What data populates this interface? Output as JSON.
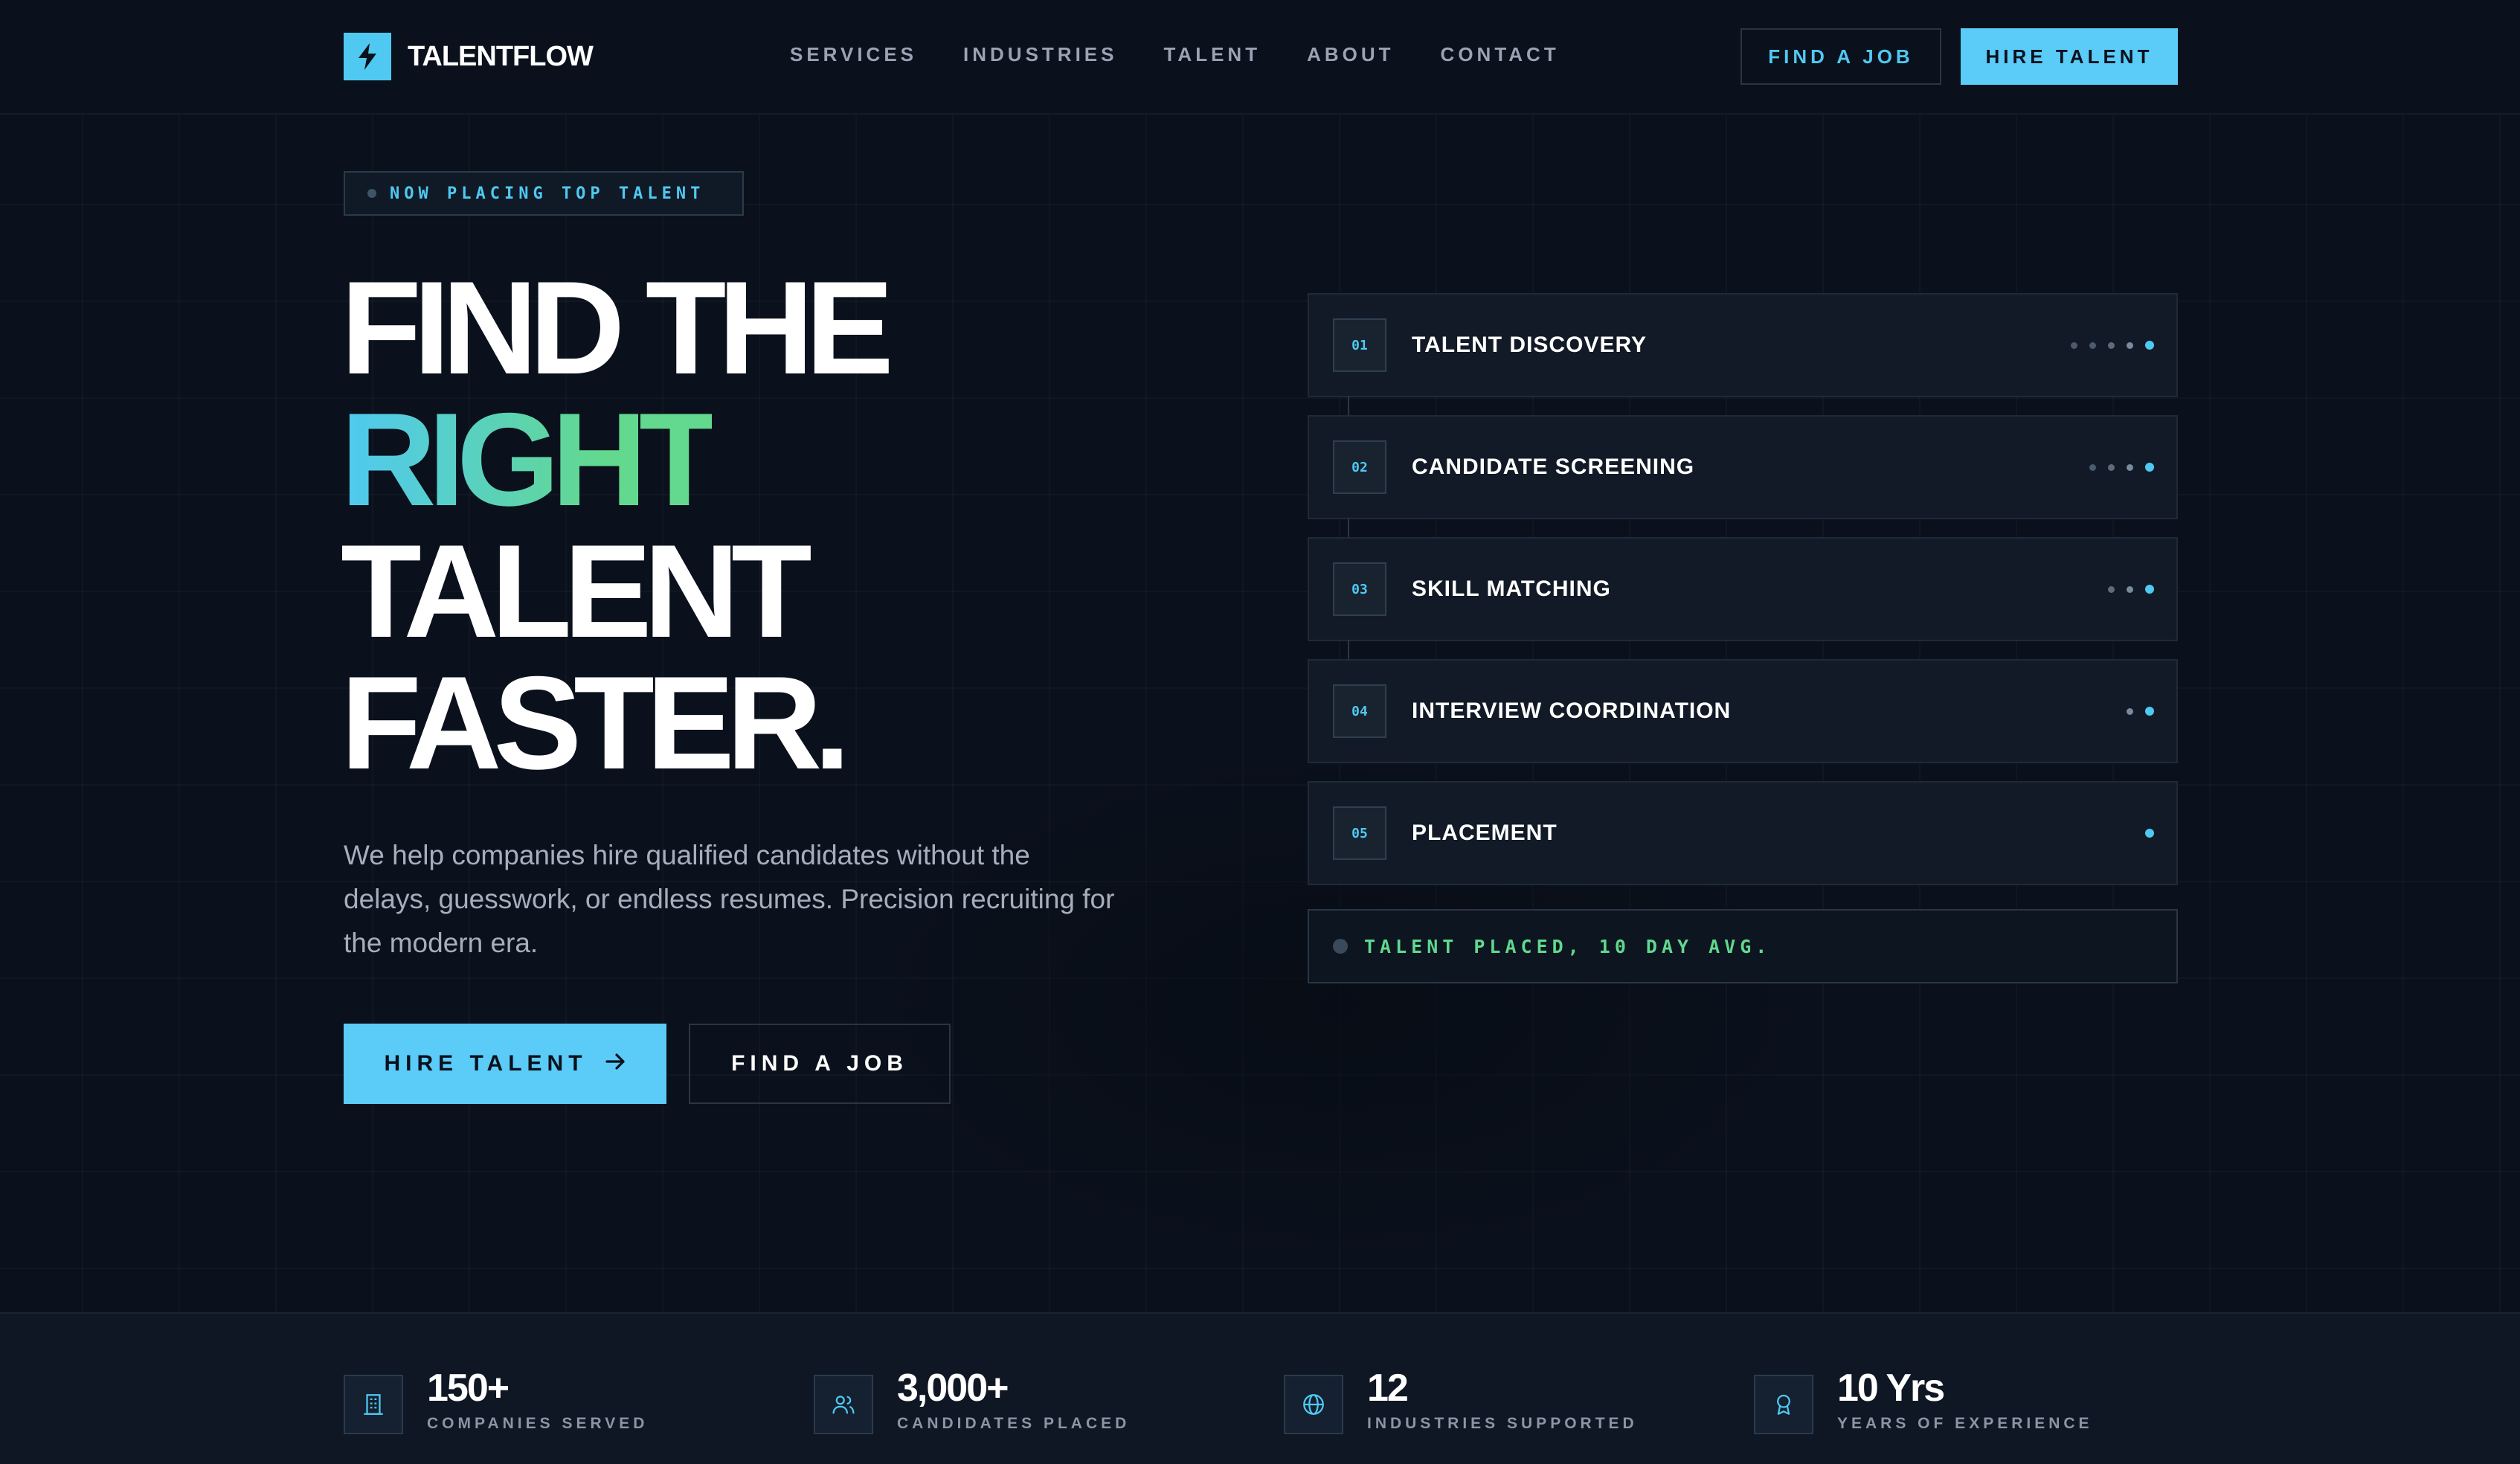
{
  "brand": {
    "name": "TALENTFLOW",
    "icon": "lightning-bolt-icon"
  },
  "nav": {
    "links": [
      "SERVICES",
      "INDUSTRIES",
      "TALENT",
      "ABOUT",
      "CONTACT"
    ],
    "find_job": "FIND A JOB",
    "hire_talent": "HIRE TALENT"
  },
  "hero": {
    "tagline": "NOW PLACING TOP TALENT",
    "headline": {
      "line1": "FIND THE",
      "line2": "RIGHT",
      "line3": "TALENT",
      "line4": "FASTER."
    },
    "description": "We help companies hire qualified candidates without the delays, guesswork, or endless resumes. Precision recruiting for the modern era.",
    "primary_cta": "HIRE TALENT",
    "secondary_cta": "FIND A JOB"
  },
  "process": {
    "steps": [
      {
        "num": "01",
        "label": "TALENT DISCOVERY",
        "level": 5
      },
      {
        "num": "02",
        "label": "CANDIDATE SCREENING",
        "level": 4
      },
      {
        "num": "03",
        "label": "SKILL MATCHING",
        "level": 3
      },
      {
        "num": "04",
        "label": "INTERVIEW COORDINATION",
        "level": 2
      },
      {
        "num": "05",
        "label": "PLACEMENT",
        "level": 1
      }
    ],
    "status": "TALENT PLACED, 10 DAY AVG."
  },
  "stats": [
    {
      "value": "150+",
      "label": "COMPANIES SERVED",
      "icon": "building-icon"
    },
    {
      "value": "3,000+",
      "label": "CANDIDATES PLACED",
      "icon": "users-icon"
    },
    {
      "value": "12",
      "label": "INDUSTRIES SUPPORTED",
      "icon": "globe-icon"
    },
    {
      "value": "10 Yrs",
      "label": "YEARS OF EXPERIENCE",
      "icon": "award-icon"
    }
  ],
  "colors": {
    "background": "#0b111c",
    "accent_blue": "#5bcbf8",
    "accent_green": "#63d88f",
    "text_muted": "#a6aebd"
  }
}
